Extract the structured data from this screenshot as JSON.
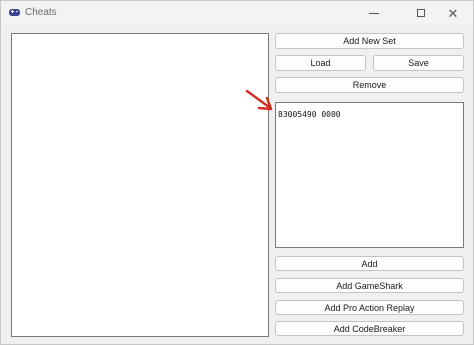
{
  "window": {
    "title": "Cheats",
    "app_icon": "gamepad-icon",
    "controls": {
      "minimize": "minimize-icon",
      "maximize": "maximize-icon",
      "close": "close-icon",
      "close_glyph": "✕"
    }
  },
  "buttons": {
    "add_new_set": "Add New Set",
    "load": "Load",
    "save": "Save",
    "remove": "Remove",
    "add": "Add",
    "add_gameshark": "Add GameShark",
    "add_pro_action_replay": "Add Pro Action Replay",
    "add_codebreaker": "Add CodeBreaker"
  },
  "code_editor": {
    "value": "83005490 0000"
  },
  "annotation": {
    "arrow_color": "#d42a20",
    "icon": "red-arrow-icon"
  },
  "colors": {
    "window_bg": "#f0f0f0",
    "button_bg": "#fdfdfd",
    "button_border": "#c4c4c4",
    "field_border": "#7a7a7a"
  }
}
